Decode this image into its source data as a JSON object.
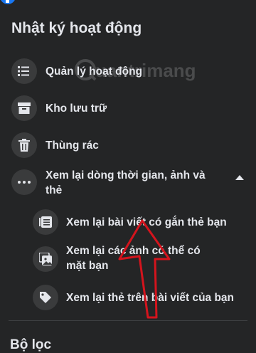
{
  "page": {
    "title": "Nhật ký hoạt động"
  },
  "menu": {
    "items": [
      {
        "label": "Quản lý hoạt động",
        "icon": "list-icon"
      },
      {
        "label": "Kho lưu trữ",
        "icon": "archive-icon"
      },
      {
        "label": "Thùng rác",
        "icon": "trash-icon"
      },
      {
        "label": "Xem lại dòng thời gian, ảnh và thẻ",
        "icon": "more-icon",
        "expanded": true
      }
    ],
    "subitems": [
      {
        "label": "Xem lại bài viết có gắn thẻ bạn",
        "icon": "post-icon"
      },
      {
        "label": "Xem lại các ảnh có thể có mặt bạn",
        "icon": "photo-icon"
      },
      {
        "label": "Xem lại thẻ trên bài viết của bạn",
        "icon": "tag-icon"
      }
    ]
  },
  "filter": {
    "heading": "Bộ lọc"
  },
  "watermark": {
    "text": "uantrimang"
  },
  "colors": {
    "background": "#242526",
    "icon_bg": "#3a3b3c",
    "text": "#e4e6eb",
    "annotation": "#d4141d"
  }
}
